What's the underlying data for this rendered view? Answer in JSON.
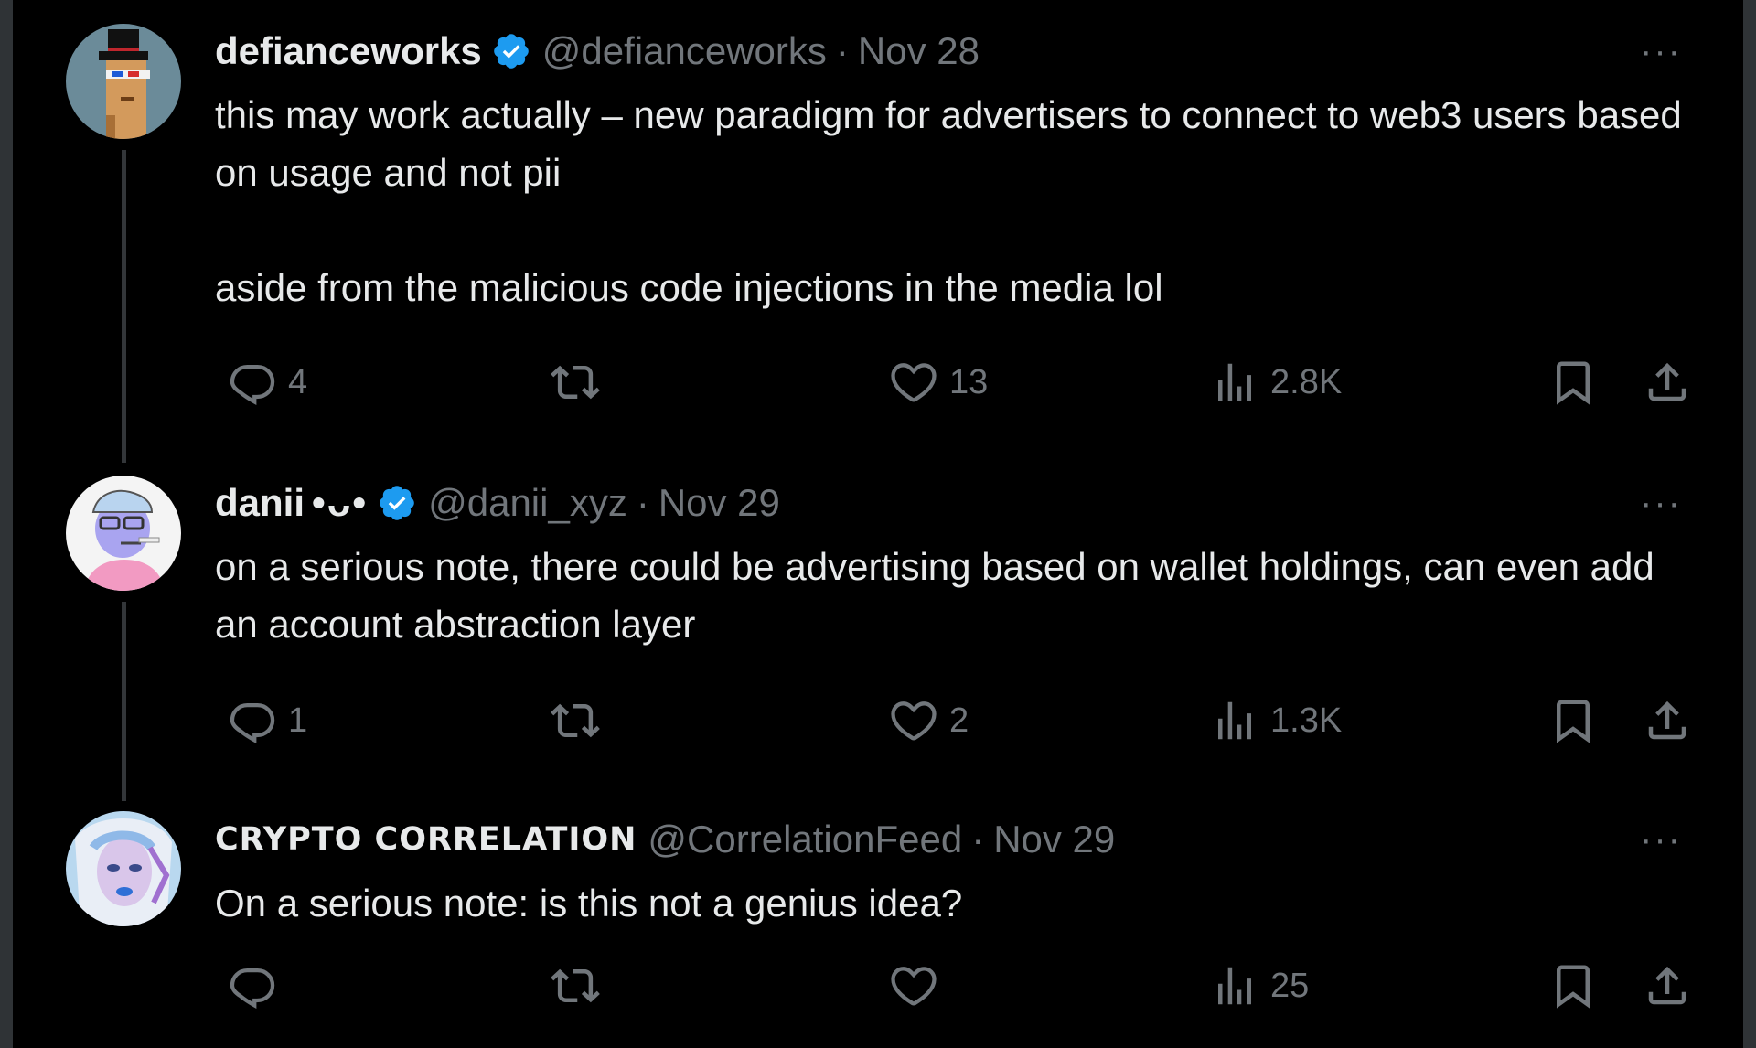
{
  "colors": {
    "background": "#000000",
    "text": "#e7e9ea",
    "muted": "#71767b",
    "verified": "#1d9bf0",
    "thread_line": "#333639"
  },
  "tweets": [
    {
      "avatar_icon": "pixel-punk-avatar",
      "name": "defianceworks",
      "verified": true,
      "handle": "@defianceworks",
      "separator": "·",
      "date": "Nov 28",
      "more_label": "···",
      "text_line1": "this may work actually – new paradigm for advertisers to connect to web3 users based on usage and not pii",
      "text_line2": "aside from the malicious code injections in the media lol",
      "replies": "4",
      "reposts": "",
      "likes": "13",
      "views": "2.8K"
    },
    {
      "avatar_icon": "cartoon-character-avatar",
      "name": "danii",
      "name_decoration": "•ᴗ•",
      "verified": true,
      "handle": "@danii_xyz",
      "separator": "·",
      "date": "Nov 29",
      "more_label": "···",
      "text_line1": "on a serious note, there could be advertising based on wallet holdings, can even add an account abstraction layer",
      "replies": "1",
      "reposts": "",
      "likes": "2",
      "views": "1.3K"
    },
    {
      "avatar_icon": "portrait-avatar",
      "name": "CRYPTO CORRELATION",
      "verified": false,
      "handle": "@CorrelationFeed",
      "separator": "·",
      "date": "Nov 29",
      "more_label": "···",
      "text_line1": "On a serious note: is this not a genius idea?",
      "replies": "",
      "reposts": "",
      "likes": "",
      "views": "25"
    }
  ]
}
